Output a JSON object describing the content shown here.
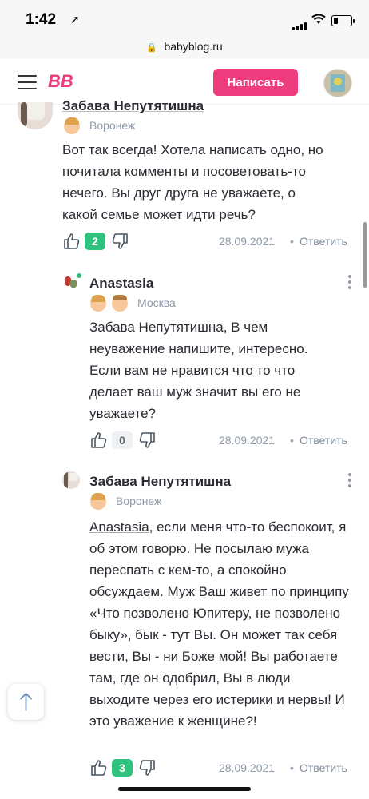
{
  "status_bar": {
    "time": "1:42",
    "location_glyph": "➚"
  },
  "browser": {
    "url": "babyblog.ru",
    "lock_glyph": "🔒"
  },
  "header": {
    "menu_icon": "hamburger-icon",
    "logo_text": "BB",
    "write_button": "Написать",
    "brand_color": "#ee3d7e"
  },
  "comments": [
    {
      "author": "Забава Непутятишна",
      "city": "Воронеж",
      "text": "Вот так всегда! Хотела написать одно, но почитала комменты и посоветовать-то нечего. Вы друг друга не уважаете, о какой семье может идти речь?",
      "votes": "2",
      "date": "28.09.2021",
      "separator": "•",
      "reply": "Ответить"
    },
    {
      "author": "Anastasia",
      "city": "Москва",
      "text": "Забава Непутятишна, В чем неуважение напишите, интересно. Если вам не нравится что то что делает ваш муж значит вы его не уважаете?",
      "votes": "0",
      "date": "28.09.2021",
      "separator": "•",
      "reply": "Ответить"
    },
    {
      "author": "Забава Непутятишна",
      "city": "Воронеж",
      "mention": "Anastasia",
      "text": ", если меня что-то беспокоит, я об этом говорю. Не посылаю мужа переспать с кем-то, а спокойно обсуждаем. Муж Ваш живет по принципу «Что позволено Юпитеру, не позволено быку», бык - тут Вы. Он может так себя вести, Вы - ни Боже мой! Вы работаете там, где он одобрил, Вы в люди выходите через его истерики и нервы! И это уважение к женщине?!",
      "votes": "3",
      "date": "28.09.2021",
      "separator": "•",
      "reply": "Ответить"
    }
  ],
  "colors": {
    "vote_positive": "#2ec27e",
    "muted": "#8e9aa8"
  }
}
